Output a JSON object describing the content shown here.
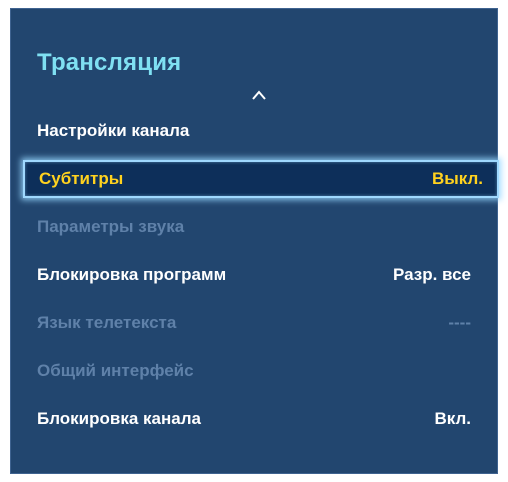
{
  "menu": {
    "title": "Трансляция",
    "scroll_up_icon": "chevron-up-icon",
    "items": [
      {
        "label": "Настройки канала",
        "value": "",
        "state": "enabled"
      },
      {
        "label": "Субтитры",
        "value": "Выкл.",
        "state": "selected"
      },
      {
        "label": "Параметры звука",
        "value": "",
        "state": "disabled"
      },
      {
        "label": "Блокировка программ",
        "value": "Разр. все",
        "state": "enabled"
      },
      {
        "label": "Язык телетекста",
        "value": "----",
        "state": "disabled"
      },
      {
        "label": "Общий интерфейс",
        "value": "",
        "state": "disabled"
      },
      {
        "label": "Блокировка канала",
        "value": "Вкл.",
        "state": "enabled"
      }
    ]
  },
  "colors": {
    "panel_background": "#22466f",
    "title": "#7fe0f2",
    "enabled_text": "#ffffff",
    "disabled_text": "#5f81a9",
    "selected_text": "#ffd21f",
    "selection_border": "#9fd9ff"
  }
}
